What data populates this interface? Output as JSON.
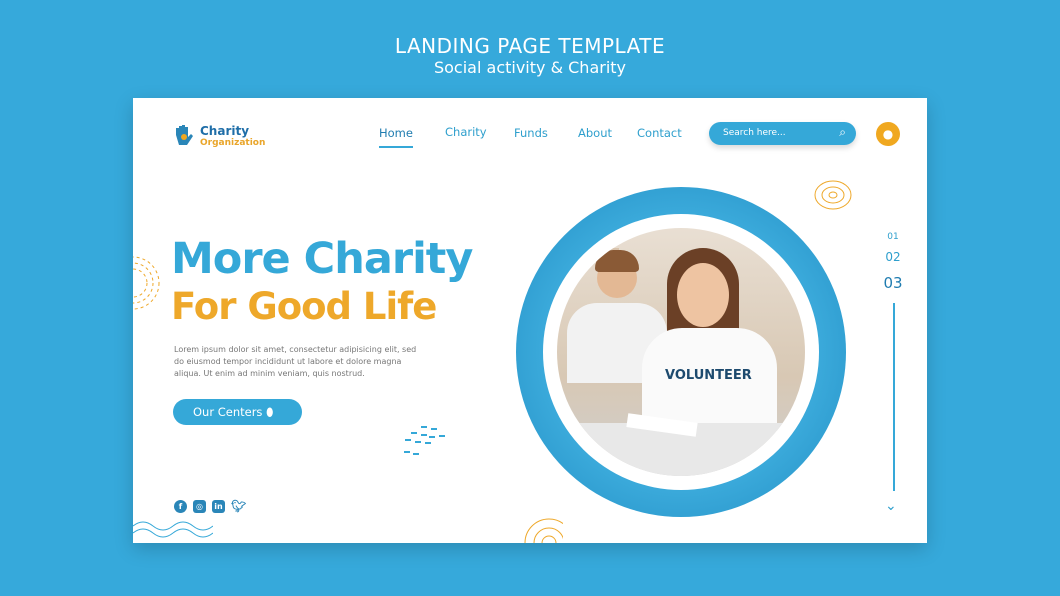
{
  "banner": {
    "title": "LANDING PAGE TEMPLATE",
    "subtitle": "Social activity & Charity"
  },
  "logo": {
    "name": "Charity",
    "tagline": "Organization"
  },
  "nav": [
    "Home",
    "Charity",
    "Funds",
    "About",
    "Contact"
  ],
  "search": {
    "placeholder": "Search here..."
  },
  "hero": {
    "line1": "More Charity",
    "line2": "For Good Life",
    "body": "Lorem ipsum dolor sit amet, consectetur adipisicing elit, sed do eiusmod tempor incididunt ut labore et dolore magna aliqua. Ut enim ad minim veniam, quis nostrud.",
    "cta": "Our Centers"
  },
  "photo": {
    "shirt_text": "VOLUNTEER"
  },
  "pagination": [
    "01",
    "02",
    "03"
  ],
  "social": [
    "facebook",
    "instagram",
    "linkedin",
    "twitter"
  ]
}
